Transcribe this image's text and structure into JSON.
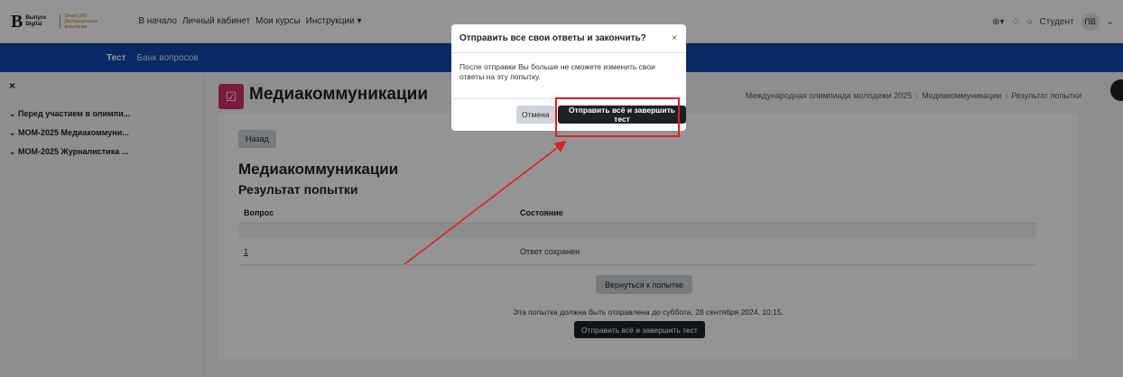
{
  "app": {
    "logo_mark": "B",
    "logo_text1": "Выпуск Digital",
    "logo_text2": "Smart LMS Дистанционные испытания"
  },
  "topnav": {
    "items": [
      "В начало",
      "Личный кабинет",
      "Мои курсы",
      "Инструкции ▾"
    ]
  },
  "user": {
    "role": "Студент",
    "initials": "ПВ"
  },
  "secondary_nav": {
    "active_tab": "Тест",
    "second_tab": "Банк вопросов"
  },
  "drawer": {
    "close": "×",
    "items": [
      "Перед участием в олимпи...",
      "МОМ-2025 Медиакоммуни...",
      "МОМ-2025 Журналистика ..."
    ]
  },
  "page": {
    "course_title": "Медиакоммуникации",
    "breadcrumb": [
      "Международная олимпиада молодежи 2025",
      "Медиакоммуникации",
      "Результат попытки"
    ],
    "back_button": "Назад",
    "quiz_heading": "Медиакоммуникации",
    "result_heading": "Результат попытки",
    "table": {
      "columns": [
        "Вопрос",
        "Состояние"
      ],
      "rows": [
        {
          "question": "1",
          "status": "Ответ сохранен"
        }
      ]
    },
    "return_button": "Вернуться к попытке",
    "deadline_text": "Эта попытка должна быть отправлена до суббота, 28 сентября 2024, 10:15.",
    "submit_button": "Отправить всё и завершить тест"
  },
  "modal": {
    "title": "Отправить все свои ответы и закончить?",
    "close": "×",
    "body": "После отправки Вы больше не сможете изменить свои ответы на эту попытку.",
    "cancel": "Отмена",
    "confirm": "Отправить всё и завершить тест"
  },
  "colors": {
    "primary_blue": "#0f47ad",
    "dark_button": "#1d2125",
    "course_icon": "#d1306b",
    "annotation_red": "#e02020"
  }
}
